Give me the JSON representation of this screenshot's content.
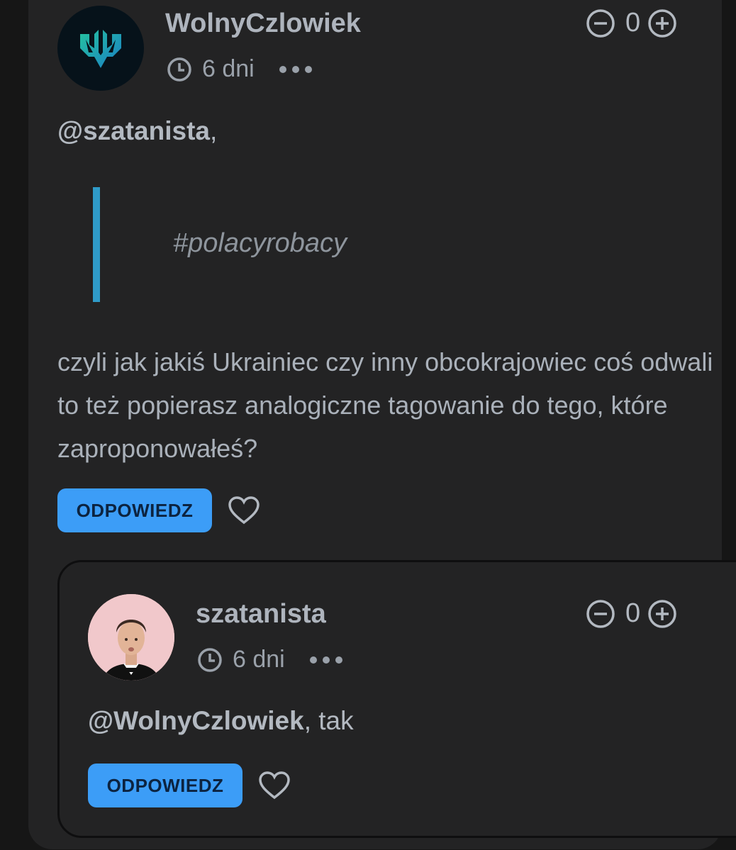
{
  "post": {
    "username": "WolnyCzlowiek",
    "time": "6 dni",
    "vote_count": "0",
    "mention": "@szatanista",
    "mention_suffix": ",",
    "quote": "#polacyrobacy",
    "body": "czyli jak jakiś Ukrainiec czy inny obcokrajowiec coś odwali to też popierasz analogiczne tagowanie do tego, które zaproponowałeś?",
    "reply_label": "ODPOWIEDZ"
  },
  "reply": {
    "username": "szatanista",
    "time": "6 dni",
    "vote_count": "0",
    "mention": "@WolnyCzlowiek",
    "mention_suffix": ", tak",
    "reply_label": "ODPOWIEDZ"
  },
  "colors": {
    "card_bg": "#232324",
    "page_bg": "#161616",
    "accent_button": "#3c9df7",
    "quote_bar": "#2f9bc9"
  },
  "icons": [
    "clock-icon",
    "more-dots-icon",
    "downvote-icon",
    "upvote-icon",
    "heart-icon"
  ]
}
